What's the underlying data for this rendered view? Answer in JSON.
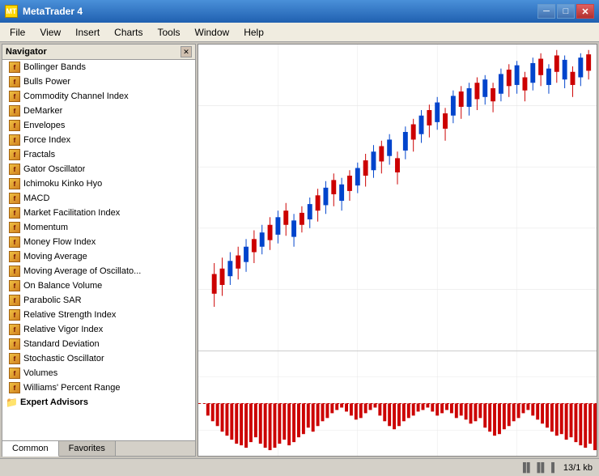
{
  "app": {
    "title": "MetaTrader 4",
    "icon": "MT"
  },
  "title_bar": {
    "minimize": "─",
    "restore": "□",
    "close": "✕"
  },
  "menu": {
    "items": [
      "File",
      "View",
      "Insert",
      "Charts",
      "Tools",
      "Window",
      "Help"
    ]
  },
  "inner_window": {
    "title": "",
    "minimize": "_",
    "restore": "□",
    "close": "✕"
  },
  "navigator": {
    "title": "Navigator",
    "close": "✕",
    "indicators": [
      "Bollinger Bands",
      "Bulls Power",
      "Commodity Channel Index",
      "DeMarker",
      "Envelopes",
      "Force Index",
      "Fractals",
      "Gator Oscillator",
      "Ichimoku Kinko Hyo",
      "MACD",
      "Market Facilitation Index",
      "Momentum",
      "Money Flow Index",
      "Moving Average",
      "Moving Average of Oscillato...",
      "On Balance Volume",
      "Parabolic SAR",
      "Relative Strength Index",
      "Relative Vigor Index",
      "Standard Deviation",
      "Stochastic Oscillator",
      "Volumes",
      "Williams' Percent Range"
    ],
    "sections": [
      "Expert Advisors"
    ],
    "tabs": [
      "Common",
      "Favorites"
    ]
  },
  "status_bar": {
    "chart_icon": "▐▌▐▌▐",
    "info": "13/1 kb"
  }
}
